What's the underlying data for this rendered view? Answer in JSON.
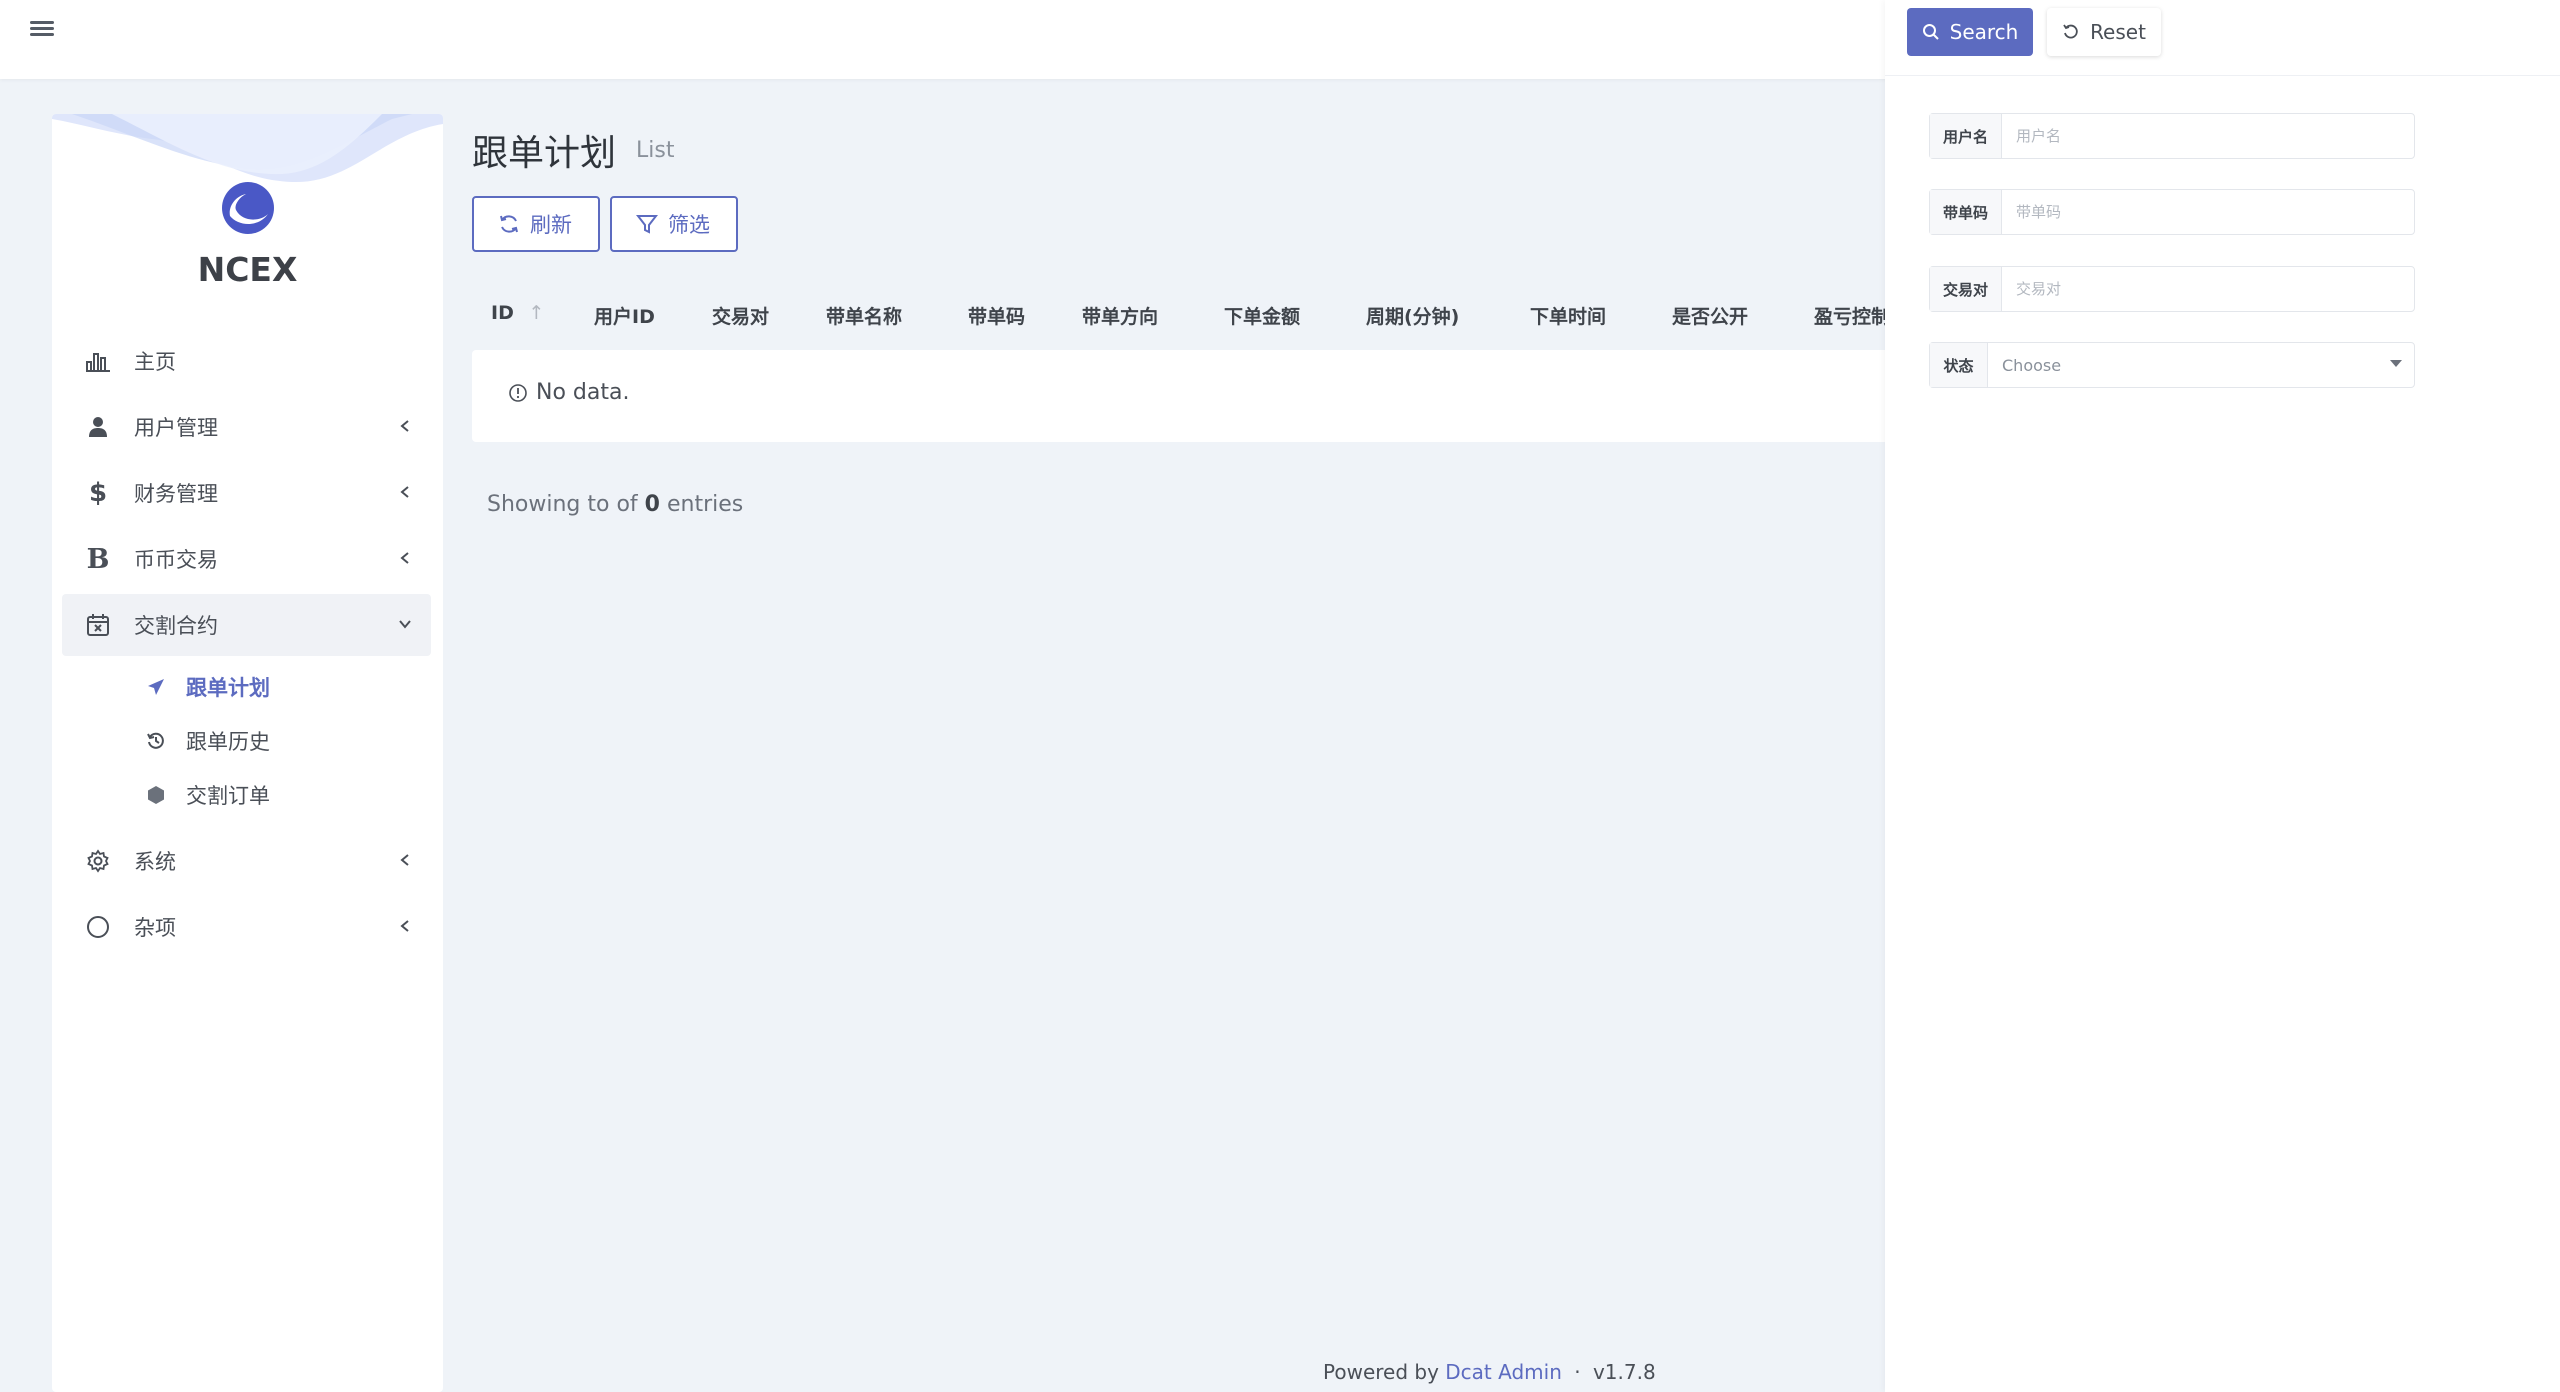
{
  "sidebar": {
    "brand": "NCEX",
    "items": [
      {
        "label": "主页",
        "icon": "bar-chart-icon",
        "has_chevron": false
      },
      {
        "label": "用户管理",
        "icon": "users-icon",
        "has_chevron": true
      },
      {
        "label": "财务管理",
        "icon": "dollar-icon",
        "has_chevron": true
      },
      {
        "label": "币币交易",
        "icon": "bitcoin-icon",
        "has_chevron": true
      },
      {
        "label": "交割合约",
        "icon": "calendar-x-icon",
        "has_chevron": true,
        "open": true
      },
      {
        "label": "系统",
        "icon": "gear-icon",
        "has_chevron": true
      },
      {
        "label": "杂项",
        "icon": "circle-icon",
        "has_chevron": true
      }
    ],
    "submenu": [
      {
        "label": "跟单计划",
        "icon": "plane-icon",
        "active": true
      },
      {
        "label": "跟单历史",
        "icon": "history-icon",
        "active": false
      },
      {
        "label": "交割订单",
        "icon": "hexagon-icon",
        "active": false
      }
    ]
  },
  "page": {
    "title": "跟单计划",
    "subtitle": "List",
    "refresh_label": "刷新",
    "filter_label": "筛选"
  },
  "table": {
    "columns": [
      "ID",
      "用户ID",
      "交易对",
      "带单名称",
      "带单码",
      "带单方向",
      "下单金额",
      "周期(分钟)",
      "下单时间",
      "是否公开",
      "盈亏控制"
    ],
    "empty_text": "No data.",
    "showing_prefix": "Showing to of",
    "showing_count": "0",
    "showing_suffix": "entries"
  },
  "footer": {
    "prefix": "Powered by",
    "link": "Dcat Admin",
    "sep": "·",
    "version": "v1.7.8"
  },
  "filter": {
    "search_label": "Search",
    "reset_label": "Reset",
    "fields": [
      {
        "label": "用户名",
        "placeholder": "用户名"
      },
      {
        "label": "带单码",
        "placeholder": "带单码"
      },
      {
        "label": "交易对",
        "placeholder": "交易对"
      }
    ],
    "status": {
      "label": "状态",
      "value": "Choose"
    }
  },
  "colors": {
    "accent": "#5c6bc0",
    "background": "#eff3f8"
  }
}
